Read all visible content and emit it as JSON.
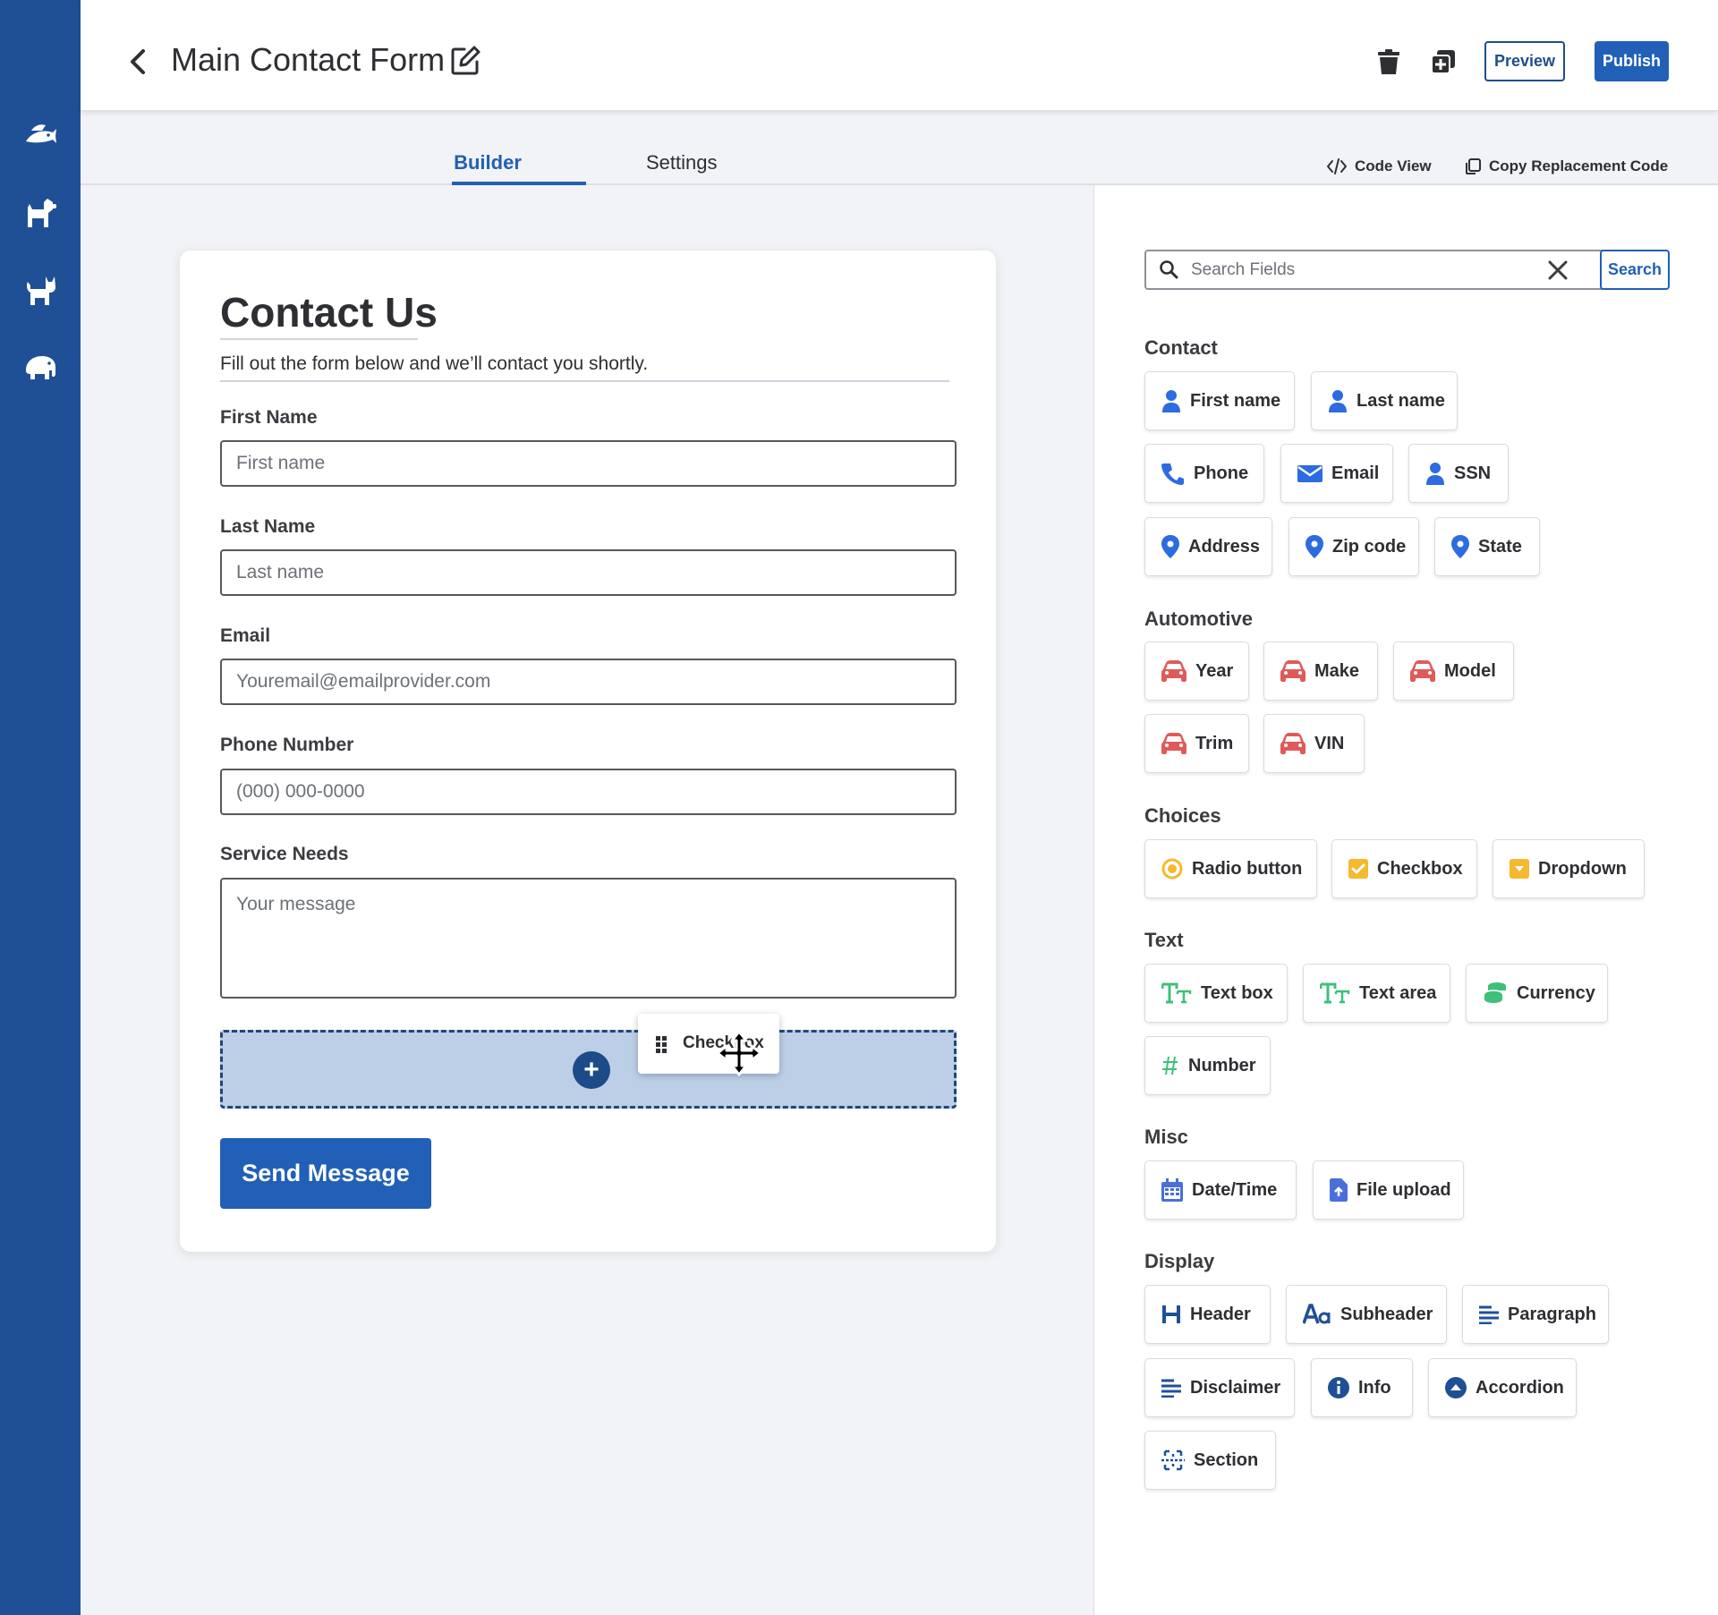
{
  "header": {
    "title": "Main Contact Form",
    "preview_label": "Preview",
    "publish_label": "Publish"
  },
  "nav_rail": {
    "icons": [
      "fish-icon",
      "dog-icon",
      "cat-icon",
      "elephant-icon"
    ]
  },
  "tabs": {
    "builder": "Builder",
    "settings": "Settings",
    "active": "Builder"
  },
  "tools": {
    "code_view": "Code View",
    "copy_code": "Copy Replacement Code"
  },
  "form": {
    "title": "Contact Us",
    "subtitle": "Fill out the form below and we’ll contact you shortly.",
    "fields": [
      {
        "label": "First Name",
        "placeholder": "First name"
      },
      {
        "label": "Last Name",
        "placeholder": "Last name"
      },
      {
        "label": "Email",
        "placeholder": "Youremail@emailprovider.com"
      },
      {
        "label": "Phone Number",
        "placeholder": "(000) 000-0000"
      },
      {
        "label": "Service Needs",
        "placeholder": "Your message"
      }
    ],
    "drop_plus": "+",
    "submit_label": "Send Message"
  },
  "drag": {
    "label": "Checkbox"
  },
  "search": {
    "placeholder": "Search Fields",
    "button_label": "Search"
  },
  "colors": {
    "brand": "#2160b6",
    "nav": "#1f5096",
    "contact_icon": "#2d6be0",
    "automotive_icon": "#e05a5a",
    "choices_icon": "#f6b82e",
    "text_icon": "#3fbf78",
    "misc_icon": "#4a6fd8",
    "display_icon": "#1f5096"
  },
  "categories": [
    {
      "name": "Contact",
      "items": [
        {
          "label": "First name",
          "icon": "person-icon"
        },
        {
          "label": "Last name",
          "icon": "person-icon"
        },
        {
          "label": "Phone",
          "icon": "phone-icon"
        },
        {
          "label": "Email",
          "icon": "envelope-icon"
        },
        {
          "label": "SSN",
          "icon": "person-icon"
        },
        {
          "label": "Address",
          "icon": "location-pin-icon"
        },
        {
          "label": "Zip code",
          "icon": "location-pin-icon"
        },
        {
          "label": "State",
          "icon": "location-pin-icon"
        }
      ]
    },
    {
      "name": "Automotive",
      "items": [
        {
          "label": "Year",
          "icon": "car-icon"
        },
        {
          "label": "Make",
          "icon": "car-icon"
        },
        {
          "label": "Model",
          "icon": "car-icon"
        },
        {
          "label": "Trim",
          "icon": "car-icon"
        },
        {
          "label": "VIN",
          "icon": "car-icon"
        }
      ]
    },
    {
      "name": "Choices",
      "items": [
        {
          "label": "Radio button",
          "icon": "radio-icon"
        },
        {
          "label": "Checkbox",
          "icon": "checkbox-icon"
        },
        {
          "label": "Dropdown",
          "icon": "dropdown-icon"
        }
      ]
    },
    {
      "name": "Text",
      "items": [
        {
          "label": "Text box",
          "icon": "text-size-icon"
        },
        {
          "label": "Text area",
          "icon": "text-size-icon"
        },
        {
          "label": "Currency",
          "icon": "coins-icon"
        },
        {
          "label": "Number",
          "icon": "hash-icon"
        }
      ]
    },
    {
      "name": "Misc",
      "items": [
        {
          "label": "Date/Time",
          "icon": "calendar-icon"
        },
        {
          "label": "File upload",
          "icon": "file-upload-icon"
        }
      ]
    },
    {
      "name": "Display",
      "items": [
        {
          "label": "Header",
          "icon": "heading-icon"
        },
        {
          "label": "Subheader",
          "icon": "font-aa-icon"
        },
        {
          "label": "Paragraph",
          "icon": "paragraph-icon"
        },
        {
          "label": "Disclaimer",
          "icon": "align-left-icon"
        },
        {
          "label": "Info",
          "icon": "info-icon"
        },
        {
          "label": "Accordion",
          "icon": "accordion-icon"
        },
        {
          "label": "Section",
          "icon": "section-icon"
        }
      ]
    }
  ]
}
